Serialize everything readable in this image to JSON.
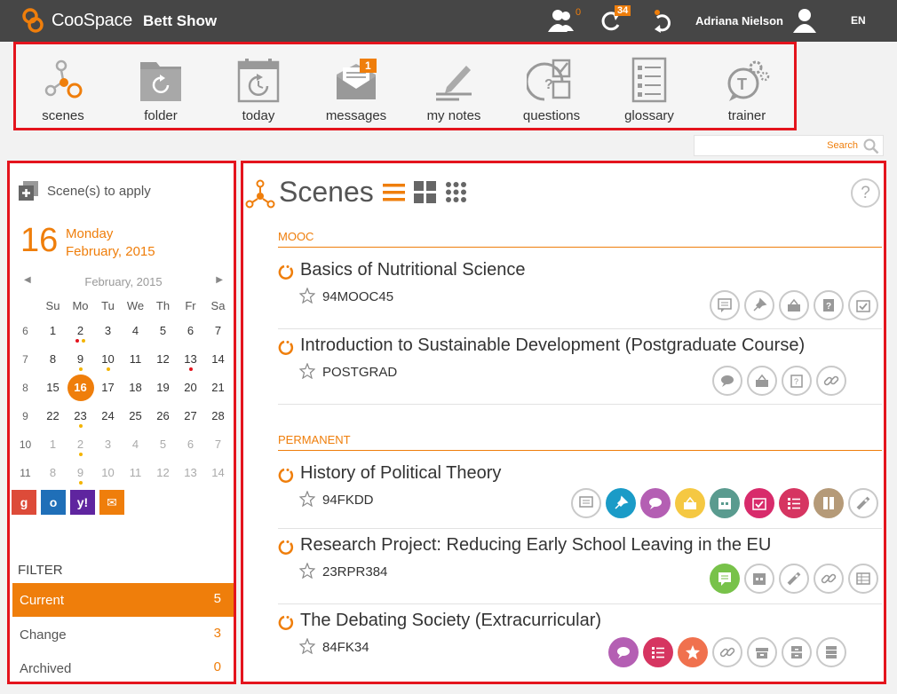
{
  "topbar": {
    "brand": "CooSpace",
    "space_name": "Bett Show",
    "participants_count": "0",
    "updates_count": "34",
    "user_name": "Adriana Nielson",
    "language": "EN"
  },
  "toolbar": {
    "items": [
      {
        "label": "scenes",
        "icon": "scenes-icon"
      },
      {
        "label": "folder",
        "icon": "folder-icon"
      },
      {
        "label": "today",
        "icon": "calendar-icon"
      },
      {
        "label": "messages",
        "icon": "envelope-icon",
        "badge": "1"
      },
      {
        "label": "my notes",
        "icon": "pencil-icon"
      },
      {
        "label": "questions",
        "icon": "question-icon"
      },
      {
        "label": "glossary",
        "icon": "list-icon"
      },
      {
        "label": "trainer",
        "icon": "trainer-icon"
      }
    ]
  },
  "search": {
    "placeholder": "Search"
  },
  "left": {
    "apply_label": "Scene(s) to apply",
    "date_number": "16",
    "date_weekday": "Monday",
    "date_month_year": "February, 2015",
    "calendar": {
      "month_label": "February, 2015",
      "weekdays": [
        "Su",
        "Mo",
        "Tu",
        "We",
        "Th",
        "Fr",
        "Sa"
      ],
      "rows": [
        {
          "week": "6",
          "days": [
            "1",
            "2",
            "3",
            "4",
            "5",
            "6",
            "7"
          ]
        },
        {
          "week": "7",
          "days": [
            "8",
            "9",
            "10",
            "11",
            "12",
            "13",
            "14"
          ]
        },
        {
          "week": "8",
          "days": [
            "15",
            "16",
            "17",
            "18",
            "19",
            "20",
            "21"
          ]
        },
        {
          "week": "9",
          "days": [
            "22",
            "23",
            "24",
            "25",
            "26",
            "27",
            "28"
          ]
        },
        {
          "week": "10",
          "days": [
            "1",
            "2",
            "3",
            "4",
            "5",
            "6",
            "7"
          ]
        },
        {
          "week": "11",
          "days": [
            "8",
            "9",
            "10",
            "11",
            "12",
            "13",
            "14"
          ]
        }
      ]
    },
    "calendar_apps": [
      "Google",
      "Outlook",
      "Yahoo",
      "Mail"
    ],
    "filter_title": "FILTER",
    "filters": [
      {
        "label": "Current",
        "count": "5"
      },
      {
        "label": "Change",
        "count": "3"
      },
      {
        "label": "Archived",
        "count": "0"
      }
    ]
  },
  "main": {
    "title": "Scenes",
    "help": "?",
    "sections": [
      {
        "title": "MOOC",
        "scenes": [
          {
            "title": "Basics of Nutritional Science",
            "code": "94MOOC45"
          },
          {
            "title": "Introduction to Sustainable Development (Postgraduate Course)",
            "code": "POSTGRAD"
          }
        ]
      },
      {
        "title": "PERMANENT",
        "scenes": [
          {
            "title": "History of Political Theory",
            "code": "94FKDD"
          },
          {
            "title": "Research Project: Reducing Early School Leaving in the EU",
            "code": "23RPR384"
          },
          {
            "title": "The Debating Society (Extracurricular)",
            "code": "84FK34"
          }
        ]
      }
    ]
  },
  "colors": {
    "accent": "#ef7e0b",
    "topbar": "#464646",
    "highlight_border": "#e4141d"
  }
}
